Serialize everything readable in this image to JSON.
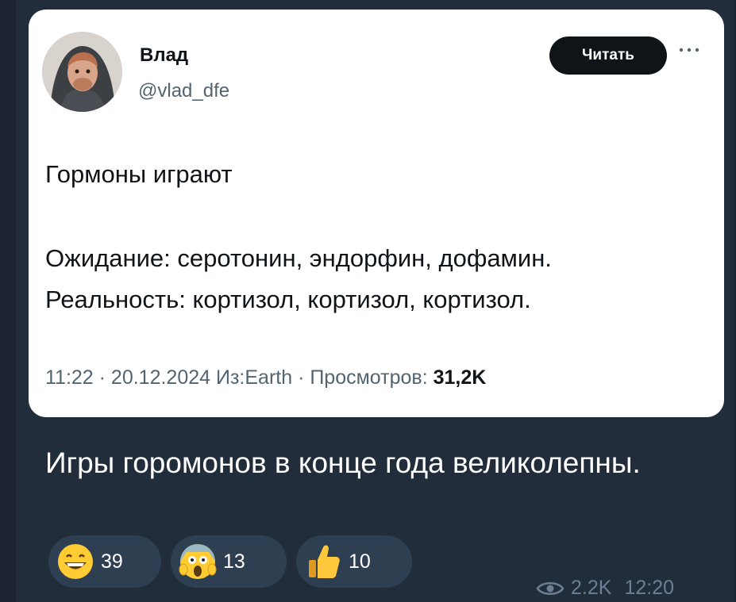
{
  "tweet": {
    "author_name": "Влад",
    "author_handle": "@vlad_dfe",
    "follow_label": "Читать",
    "text_line1": "Гормоны играют",
    "text_line2": "Ожидание: серотонин, эндорфин, дофамин.",
    "text_line3": "Реальность: кортизол, кортизол, кортизол.",
    "meta_prefix": "11:22 · 20.12.2024 Из:Earth · Просмотров: ",
    "views": "31,2K"
  },
  "message": {
    "caption": "Игры горомонов в конце года великолепны.",
    "reactions": [
      {
        "emoji": "grinning-face",
        "count": "39"
      },
      {
        "emoji": "screaming-face",
        "count": "13"
      },
      {
        "emoji": "thumbs-up",
        "count": "10"
      }
    ],
    "view_count": "2.2K",
    "time": "12:20"
  }
}
